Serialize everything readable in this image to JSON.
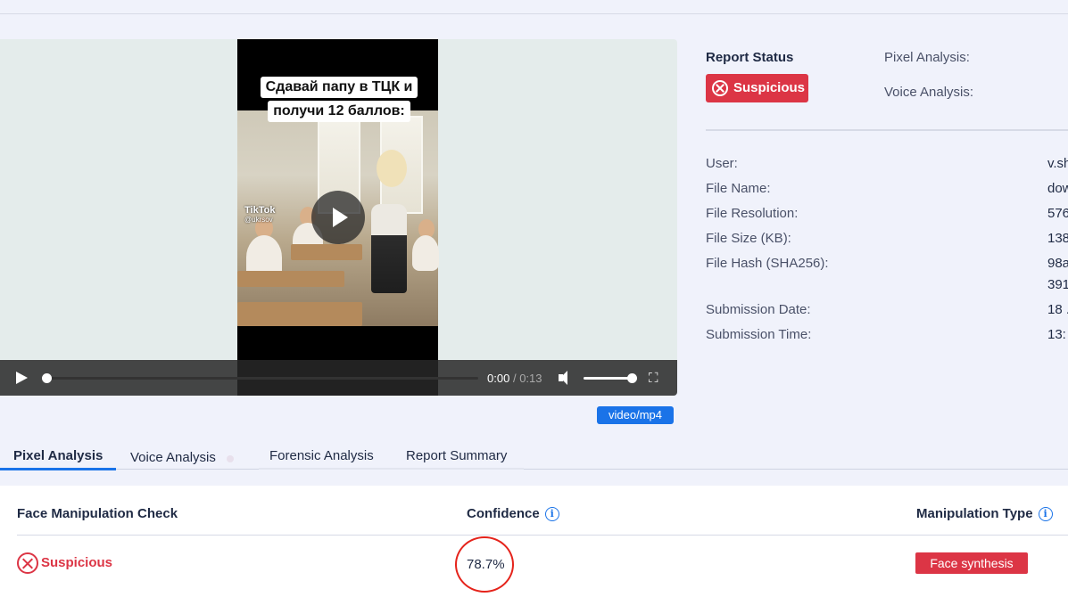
{
  "video": {
    "caption_line1": "Сдавай папу в ТЦК и",
    "caption_line2": "получи 12 баллов:",
    "watermark_brand": "TikTok",
    "watermark_handle": "@ukrsov",
    "current_time": "0:00",
    "separator": "/",
    "duration": "0:13",
    "progress_fraction": 0.0,
    "volume_fraction": 1.0,
    "mime_type": "video/mp4"
  },
  "report": {
    "status_label": "Report Status",
    "status_value": "Suspicious",
    "pixel_analysis_label": "Pixel Analysis:",
    "voice_analysis_label": "Voice Analysis:",
    "meta": [
      {
        "key": "User:",
        "value": "v.sh"
      },
      {
        "key": "File Name:",
        "value": "dow"
      },
      {
        "key": "File Resolution:",
        "value": "576"
      },
      {
        "key": "File Size (KB):",
        "value": "138"
      },
      {
        "key": "File Hash (SHA256):",
        "value": "98a",
        "value2": "391"
      },
      {
        "key": "Submission Date:",
        "value": "18 ."
      },
      {
        "key": "Submission Time:",
        "value": "13:"
      }
    ]
  },
  "tabs": [
    {
      "label": "Pixel Analysis",
      "active": true
    },
    {
      "label": "Voice Analysis",
      "active": false
    },
    {
      "label": "Forensic Analysis",
      "active": false
    },
    {
      "label": "Report Summary",
      "active": false
    }
  ],
  "analysis": {
    "col1_header": "Face Manipulation Check",
    "col2_header": "Confidence",
    "col3_header": "Manipulation Type",
    "row": {
      "check_result": "Suspicious",
      "confidence": "78.7%",
      "manipulation_type": "Face synthesis"
    },
    "info_glyph": "i"
  },
  "colors": {
    "accent": "#1a73e8",
    "danger": "#dc3545",
    "annotation_circle": "#e5231b",
    "background": "#f0f2fb"
  },
  "icons": [
    "play-icon",
    "volume-icon",
    "fullscreen-icon",
    "x-circle-icon",
    "info-icon"
  ]
}
